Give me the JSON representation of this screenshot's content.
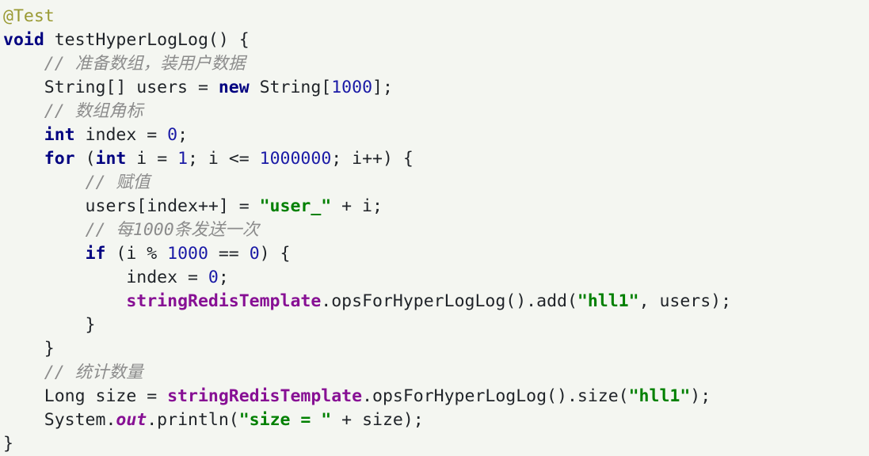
{
  "document": {
    "kind": "java-code-snippet",
    "language": "Java",
    "background_color": "#f4f6f1",
    "palette": {
      "annotation": "#9a9a33",
      "keyword": "#000080",
      "comment": "#8c8c8c",
      "number": "#1a1aa6",
      "string": "#008000",
      "field": "#871094",
      "plain": "#1f2328"
    }
  },
  "code": {
    "plain_text": "@Test\nvoid testHyperLogLog() {\n    // 准备数组，装用户数据\n    String[] users = new String[1000];\n    // 数组角标\n    int index = 0;\n    for (int i = 1; i <= 1000000; i++) {\n        // 赋值\n        users[index++] = \"user_\" + i;\n        // 每1000条发送一次\n        if (i % 1000 == 0) {\n            index = 0;\n            stringRedisTemplate.opsForHyperLogLog().add(\"hll1\", users);\n        }\n    }\n    // 统计数量\n    Long size = stringRedisTemplate.opsForHyperLogLog().size(\"hll1\");\n    System.out.println(\"size = \" + size);\n}",
    "lines": [
      {
        "index": 1,
        "text": "@Test",
        "tokens": [
          {
            "t": "@Test",
            "c": "annotation"
          }
        ]
      },
      {
        "index": 2,
        "text": "void testHyperLogLog() {",
        "tokens": [
          {
            "t": "void",
            "c": "keyword"
          },
          {
            "t": " testHyperLogLog() {",
            "c": "plain"
          }
        ]
      },
      {
        "index": 3,
        "text": "    // 准备数组，装用户数据",
        "tokens": [
          {
            "t": "    ",
            "c": "plain"
          },
          {
            "t": "// 准备数组，装用户数据",
            "c": "comment"
          }
        ]
      },
      {
        "index": 4,
        "text": "    String[] users = new String[1000];",
        "tokens": [
          {
            "t": "    String[] users = ",
            "c": "plain"
          },
          {
            "t": "new",
            "c": "keyword"
          },
          {
            "t": " String[",
            "c": "plain"
          },
          {
            "t": "1000",
            "c": "number"
          },
          {
            "t": "];",
            "c": "plain"
          }
        ]
      },
      {
        "index": 5,
        "text": "    // 数组角标",
        "tokens": [
          {
            "t": "    ",
            "c": "plain"
          },
          {
            "t": "// 数组角标",
            "c": "comment"
          }
        ]
      },
      {
        "index": 6,
        "text": "    int index = 0;",
        "tokens": [
          {
            "t": "    ",
            "c": "plain"
          },
          {
            "t": "int",
            "c": "keyword"
          },
          {
            "t": " index = ",
            "c": "plain"
          },
          {
            "t": "0",
            "c": "number"
          },
          {
            "t": ";",
            "c": "plain"
          }
        ]
      },
      {
        "index": 7,
        "text": "    for (int i = 1; i <= 1000000; i++) {",
        "tokens": [
          {
            "t": "    ",
            "c": "plain"
          },
          {
            "t": "for",
            "c": "keyword"
          },
          {
            "t": " (",
            "c": "plain"
          },
          {
            "t": "int",
            "c": "keyword"
          },
          {
            "t": " i = ",
            "c": "plain"
          },
          {
            "t": "1",
            "c": "number"
          },
          {
            "t": "; i <= ",
            "c": "plain"
          },
          {
            "t": "1000000",
            "c": "number"
          },
          {
            "t": "; i++) {",
            "c": "plain"
          }
        ]
      },
      {
        "index": 8,
        "text": "        // 赋值",
        "tokens": [
          {
            "t": "        ",
            "c": "plain"
          },
          {
            "t": "// 赋值",
            "c": "comment"
          }
        ]
      },
      {
        "index": 9,
        "text": "        users[index++] = \"user_\" + i;",
        "tokens": [
          {
            "t": "        users[index++] = ",
            "c": "plain"
          },
          {
            "t": "\"user_\"",
            "c": "string"
          },
          {
            "t": " + i;",
            "c": "plain"
          }
        ]
      },
      {
        "index": 10,
        "text": "        // 每1000条发送一次",
        "tokens": [
          {
            "t": "        ",
            "c": "plain"
          },
          {
            "t": "// 每1000条发送一次",
            "c": "comment"
          }
        ]
      },
      {
        "index": 11,
        "text": "        if (i % 1000 == 0) {",
        "tokens": [
          {
            "t": "        ",
            "c": "plain"
          },
          {
            "t": "if",
            "c": "keyword"
          },
          {
            "t": " (i % ",
            "c": "plain"
          },
          {
            "t": "1000",
            "c": "number"
          },
          {
            "t": " == ",
            "c": "plain"
          },
          {
            "t": "0",
            "c": "number"
          },
          {
            "t": ") {",
            "c": "plain"
          }
        ]
      },
      {
        "index": 12,
        "text": "            index = 0;",
        "tokens": [
          {
            "t": "            index = ",
            "c": "plain"
          },
          {
            "t": "0",
            "c": "number"
          },
          {
            "t": ";",
            "c": "plain"
          }
        ]
      },
      {
        "index": 13,
        "text": "            stringRedisTemplate.opsForHyperLogLog().add(\"hll1\", users);",
        "tokens": [
          {
            "t": "            ",
            "c": "plain"
          },
          {
            "t": "stringRedisTemplate",
            "c": "field"
          },
          {
            "t": ".opsForHyperLogLog().add(",
            "c": "plain"
          },
          {
            "t": "\"hll1\"",
            "c": "string"
          },
          {
            "t": ", users);",
            "c": "plain"
          }
        ]
      },
      {
        "index": 14,
        "text": "        }",
        "tokens": [
          {
            "t": "        }",
            "c": "plain"
          }
        ]
      },
      {
        "index": 15,
        "text": "    }",
        "tokens": [
          {
            "t": "    }",
            "c": "plain"
          }
        ]
      },
      {
        "index": 16,
        "text": "    // 统计数量",
        "tokens": [
          {
            "t": "    ",
            "c": "plain"
          },
          {
            "t": "// 统计数量",
            "c": "comment"
          }
        ]
      },
      {
        "index": 17,
        "text": "    Long size = stringRedisTemplate.opsForHyperLogLog().size(\"hll1\");",
        "tokens": [
          {
            "t": "    Long size = ",
            "c": "plain"
          },
          {
            "t": "stringRedisTemplate",
            "c": "field"
          },
          {
            "t": ".opsForHyperLogLog().size(",
            "c": "plain"
          },
          {
            "t": "\"hll1\"",
            "c": "string"
          },
          {
            "t": ");",
            "c": "plain"
          }
        ]
      },
      {
        "index": 18,
        "text": "    System.out.println(\"size = \" + size);",
        "tokens": [
          {
            "t": "    System.",
            "c": "plain"
          },
          {
            "t": "out",
            "c": "static"
          },
          {
            "t": ".println(",
            "c": "plain"
          },
          {
            "t": "\"size = \"",
            "c": "string"
          },
          {
            "t": " + size);",
            "c": "plain"
          }
        ]
      },
      {
        "index": 19,
        "text": "}",
        "tokens": [
          {
            "t": "}",
            "c": "plain"
          }
        ]
      }
    ]
  }
}
